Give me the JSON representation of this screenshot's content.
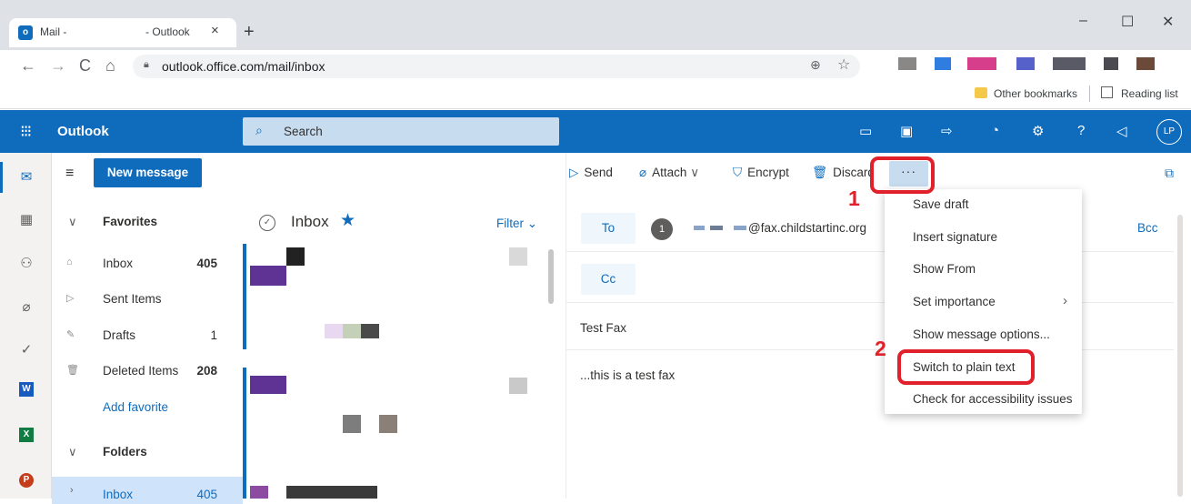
{
  "browser": {
    "tab": {
      "title_part1": "Mail -",
      "title_part2": "- Outlook",
      "close_glyph": "×"
    },
    "new_tab_glyph": "+",
    "window": {
      "minimize": "–",
      "maximize": "☐",
      "close": "✕"
    },
    "nav": {
      "back": "←",
      "forward": "→",
      "reload": "C",
      "home": "⌂"
    },
    "url": "outlook.office.com/mail/inbox",
    "bookmarks": {
      "other": "Other bookmarks",
      "reading_list": "Reading list"
    },
    "icons": [
      "lock-icon",
      "install-icon",
      "star-icon",
      "folder-icon",
      "reading-list-icon"
    ]
  },
  "outlook": {
    "brand": "Outlook",
    "search_placeholder": "Search",
    "user_initials": "LP",
    "header_icons": [
      "meet-now-icon",
      "teams-icon",
      "my-day-icon",
      "bell-icon",
      "gear-icon",
      "help-icon",
      "feedback-icon"
    ],
    "accent": "#0f6cbd"
  },
  "folder_pane": {
    "new_message": "New message",
    "favorites": {
      "heading": "Favorites",
      "items": [
        {
          "label": "Inbox",
          "count": "405",
          "icon": "inbox-icon"
        },
        {
          "label": "Sent Items",
          "count": "",
          "icon": "sent-icon"
        },
        {
          "label": "Drafts",
          "count": "1",
          "icon": "pencil-icon"
        },
        {
          "label": "Deleted Items",
          "count": "208",
          "icon": "trash-icon"
        }
      ],
      "add_favorite": "Add favorite"
    },
    "folders": {
      "heading": "Folders",
      "items": [
        {
          "label": "Inbox",
          "count": "405"
        }
      ]
    }
  },
  "message_list": {
    "title": "Inbox",
    "filter": "Filter"
  },
  "command_bar": {
    "send": "Send",
    "attach": "Attach",
    "encrypt": "Encrypt",
    "discard": "Discard",
    "more": "···"
  },
  "compose": {
    "to_label": "To",
    "cc_label": "Cc",
    "bcc_label": "Bcc",
    "recipient_initial": "1",
    "recipient_address": "@fax.childstartinc.org",
    "subject": "Test Fax",
    "body": "...this is a test fax"
  },
  "more_menu": {
    "items": [
      "Save draft",
      "Insert signature",
      "Show From",
      "Set importance",
      "Show message options...",
      "Switch to plain text",
      "Check for accessibility issues"
    ]
  },
  "annotations": {
    "step1": "1",
    "step2": "2",
    "color": "#e0202a"
  }
}
